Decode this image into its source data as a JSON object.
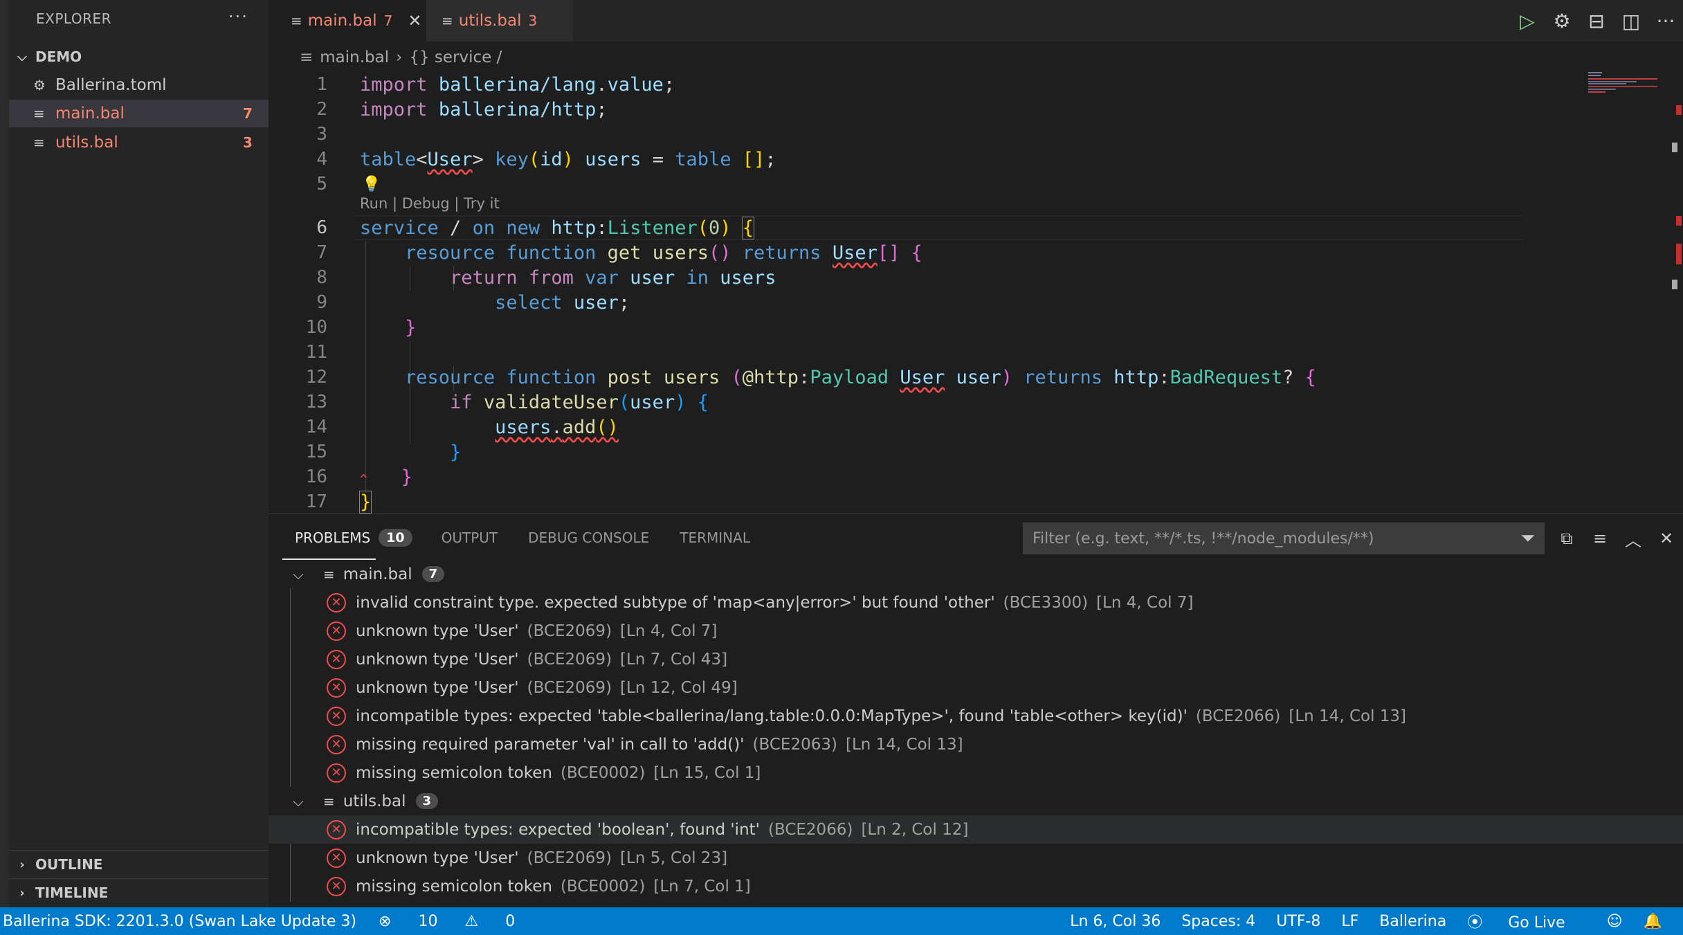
{
  "sidebar": {
    "title": "EXPLORER",
    "more_icon": "ellipsis-icon",
    "project": "DEMO",
    "files": [
      {
        "name": "Ballerina.toml",
        "icon": "gear-icon",
        "count": ""
      },
      {
        "name": "main.bal",
        "icon": "lines-icon",
        "count": "7"
      },
      {
        "name": "utils.bal",
        "icon": "lines-icon",
        "count": "3"
      }
    ],
    "outline_label": "OUTLINE",
    "timeline_label": "TIMELINE"
  },
  "tabs": [
    {
      "label": "main.bal",
      "count": "7",
      "active": true
    },
    {
      "label": "utils.bal",
      "count": "3",
      "active": false
    }
  ],
  "breadcrumb": [
    "main.bal",
    "{} service /"
  ],
  "editor": {
    "codelens": "Run | Debug | Try it",
    "line_numbers": [
      "1",
      "2",
      "3",
      "4",
      "5",
      "6",
      "7",
      "8",
      "9",
      "10",
      "11",
      "12",
      "13",
      "14",
      "15",
      "16",
      "17"
    ]
  },
  "panel": {
    "tabs": [
      {
        "label": "PROBLEMS",
        "badge": "10"
      },
      {
        "label": "OUTPUT"
      },
      {
        "label": "DEBUG CONSOLE"
      },
      {
        "label": "TERMINAL"
      }
    ],
    "filter_placeholder": "Filter (e.g. text, **/*.ts, !**/node_modules/**)",
    "groups": [
      {
        "file": "main.bal",
        "count": "7",
        "problems": [
          {
            "message": "invalid constraint type. expected subtype of 'map<any|error>' but found 'other'",
            "code": "(BCE3300)",
            "loc": "[Ln 4, Col 7]"
          },
          {
            "message": "unknown type 'User'",
            "code": "(BCE2069)",
            "loc": "[Ln 4, Col 7]"
          },
          {
            "message": "unknown type 'User'",
            "code": "(BCE2069)",
            "loc": "[Ln 7, Col 43]"
          },
          {
            "message": "unknown type 'User'",
            "code": "(BCE2069)",
            "loc": "[Ln 12, Col 49]"
          },
          {
            "message": "incompatible types: expected 'table<ballerina/lang.table:0.0.0:MapType>', found 'table<other> key(id)'",
            "code": "(BCE2066)",
            "loc": "[Ln 14, Col 13]"
          },
          {
            "message": "missing required parameter 'val' in call to 'add()'",
            "code": "(BCE2063)",
            "loc": "[Ln 14, Col 13]"
          },
          {
            "message": "missing semicolon token",
            "code": "(BCE0002)",
            "loc": "[Ln 15, Col 1]"
          }
        ]
      },
      {
        "file": "utils.bal",
        "count": "3",
        "problems": [
          {
            "message": "incompatible types: expected 'boolean', found 'int'",
            "code": "(BCE2066)",
            "loc": "[Ln 2, Col 12]"
          },
          {
            "message": "unknown type 'User'",
            "code": "(BCE2069)",
            "loc": "[Ln 5, Col 23]"
          },
          {
            "message": "missing semicolon token",
            "code": "(BCE0002)",
            "loc": "[Ln 7, Col 1]"
          }
        ]
      }
    ]
  },
  "statusbar": {
    "sdk": "Ballerina SDK: 2201.3.0 (Swan Lake Update 3)",
    "errors": "10",
    "warnings": "0",
    "position": "Ln 6, Col 36",
    "spaces": "Spaces: 4",
    "encoding": "UTF-8",
    "eol": "LF",
    "language": "Ballerina",
    "golive": "Go Live"
  },
  "colors": {
    "accent": "#007acc",
    "error": "#f14c4c",
    "error_text": "#f48771"
  }
}
